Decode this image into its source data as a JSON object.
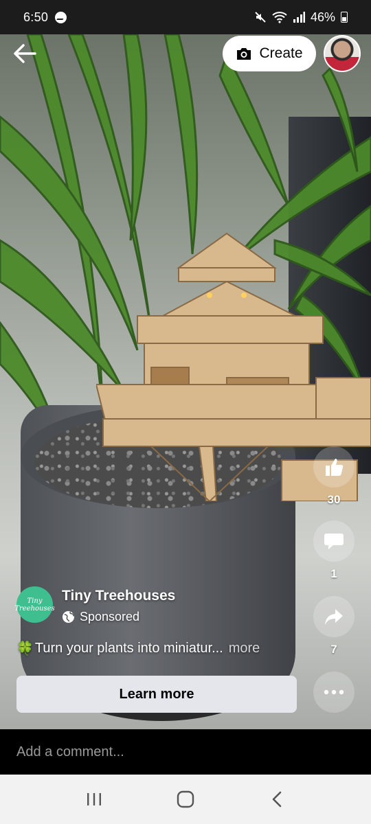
{
  "status_bar": {
    "time": "6:50",
    "battery": "46%"
  },
  "header": {
    "create_label": "Create"
  },
  "actions": {
    "like_count": "30",
    "comment_count": "1",
    "share_count": "7"
  },
  "ad": {
    "page_name": "Tiny Treehouses",
    "avatar_line1": "Tiny",
    "avatar_line2": "Treehouses",
    "sponsored_label": "Sponsored",
    "caption_emoji": "🍀",
    "caption_text": "Turn your plants into miniatur...",
    "more_label": "more",
    "cta_label": "Learn more"
  },
  "comment": {
    "placeholder": "Add a comment..."
  },
  "icons": {
    "back": "arrow-left-icon",
    "camera": "camera-icon",
    "like": "thumbs-up-icon",
    "comment": "speech-bubble-icon",
    "share": "share-arrow-icon",
    "more": "more-dots-icon",
    "globe": "globe-icon",
    "recents": "recent-apps-icon",
    "home": "home-icon",
    "nav_back": "chevron-left-icon"
  },
  "colors": {
    "brand_green": "#3fbf8f",
    "cta_bg": "#e4e6eb",
    "nav_bg": "#f2f2f2"
  }
}
